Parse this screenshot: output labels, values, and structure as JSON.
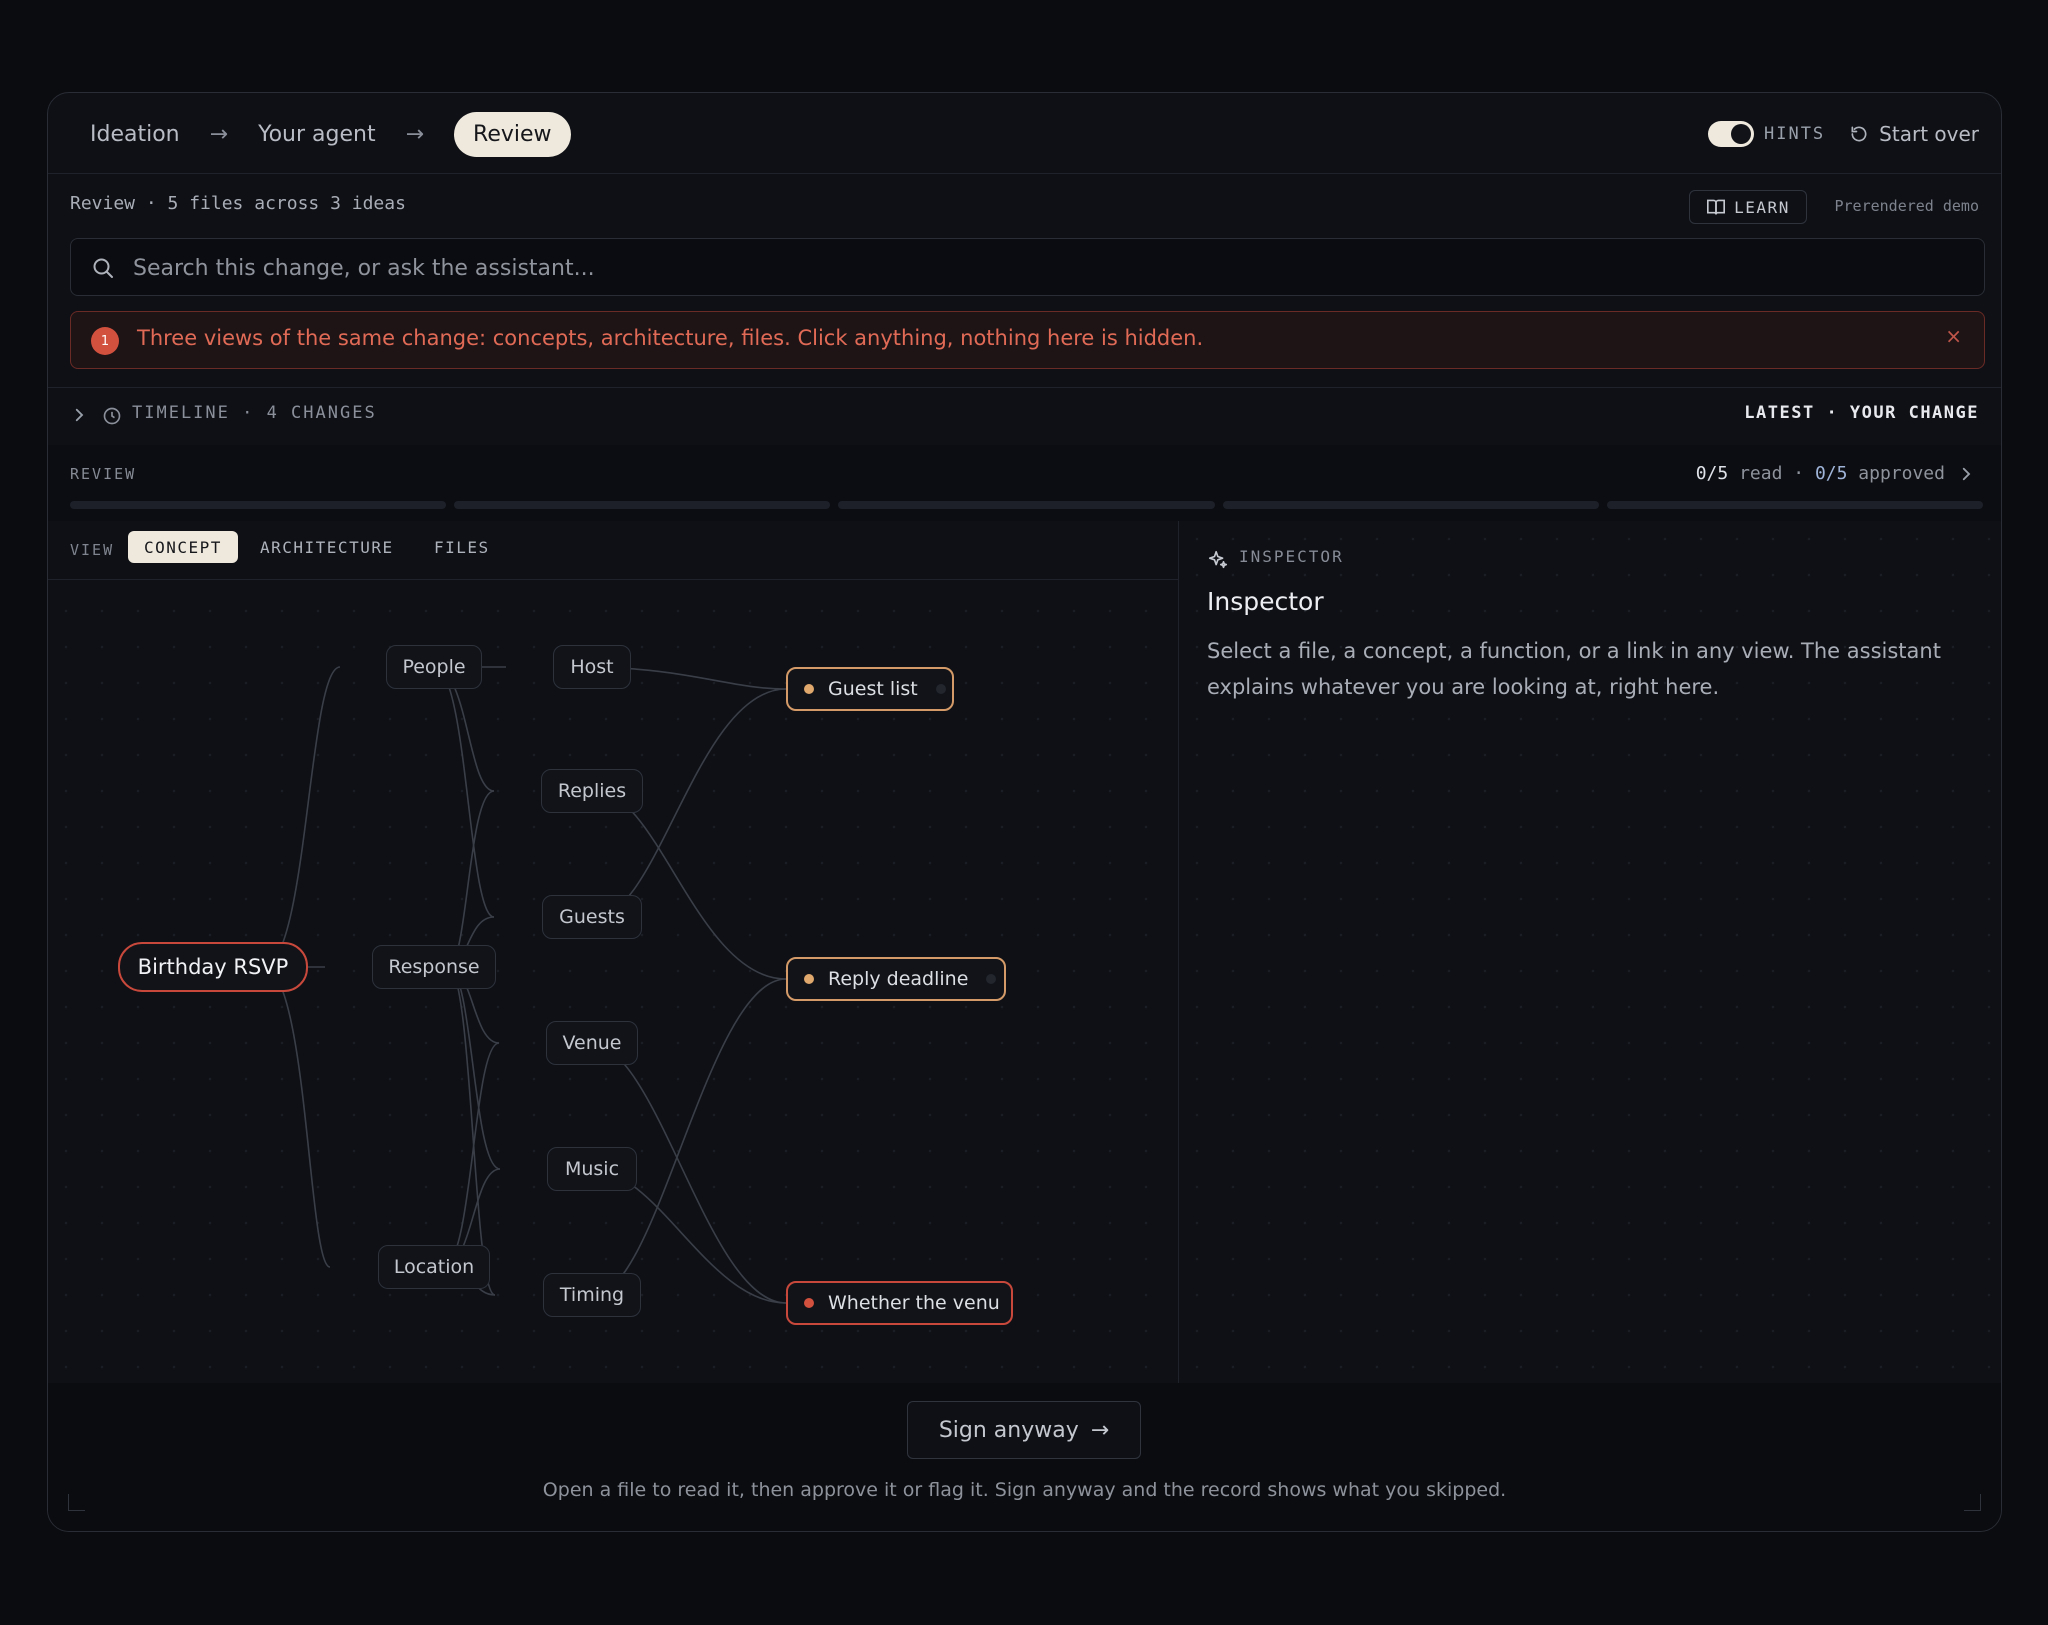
{
  "nav": {
    "crumbs": [
      "Ideation",
      "Your agent",
      "Review"
    ],
    "arrow": "→",
    "hints_label": "HINTS",
    "start_over": "Start over"
  },
  "review_header": {
    "summary": "Review · 5 files across 3 ideas",
    "learn_label": "LEARN",
    "prerendered": "Prerendered demo"
  },
  "search": {
    "placeholder": "Search this change, or ask the assistant..."
  },
  "alert": {
    "badge": "1",
    "text": "Three views of the same change: concepts, architecture, files. Click anything, nothing here is hidden.",
    "close": "×"
  },
  "timeline": {
    "label": "TIMELINE · 4 CHANGES",
    "right": "LATEST · YOUR CHANGE"
  },
  "review_bar": {
    "label": "REVIEW",
    "read_count": "0/5",
    "read_label": " read · ",
    "approved_count": "0/5",
    "approved_label": " approved",
    "segments": 5
  },
  "view": {
    "label": "VIEW",
    "tabs": [
      "CONCEPT",
      "ARCHITECTURE",
      "FILES"
    ],
    "active": "CONCEPT"
  },
  "graph": {
    "root": "Birthday RSVP",
    "groups": [
      "People",
      "Response",
      "Location"
    ],
    "leaves": [
      "Host",
      "Replies",
      "Guests",
      "Venue",
      "Music",
      "Timing"
    ],
    "outcomes": [
      {
        "label": "Guest list",
        "status": "orange"
      },
      {
        "label": "Reply deadline",
        "status": "orange"
      },
      {
        "label": "Whether the venu",
        "status": "red"
      }
    ]
  },
  "inspector": {
    "kicker": "INSPECTOR",
    "title": "Inspector",
    "body": "Select a file, a concept, a function, or a link in any view. The assistant explains whatever you are looking at, right here."
  },
  "footer": {
    "sign_label": "Sign anyway",
    "sign_arrow": "→",
    "note": "Open a file to read it, then approve it or flag it. Sign anyway and the record shows what you skipped."
  },
  "colors": {
    "accent_cream": "#efe9dd",
    "alert_red": "#e06a55",
    "outcome_orange": "#d49b68",
    "outcome_red": "#c8493c"
  }
}
